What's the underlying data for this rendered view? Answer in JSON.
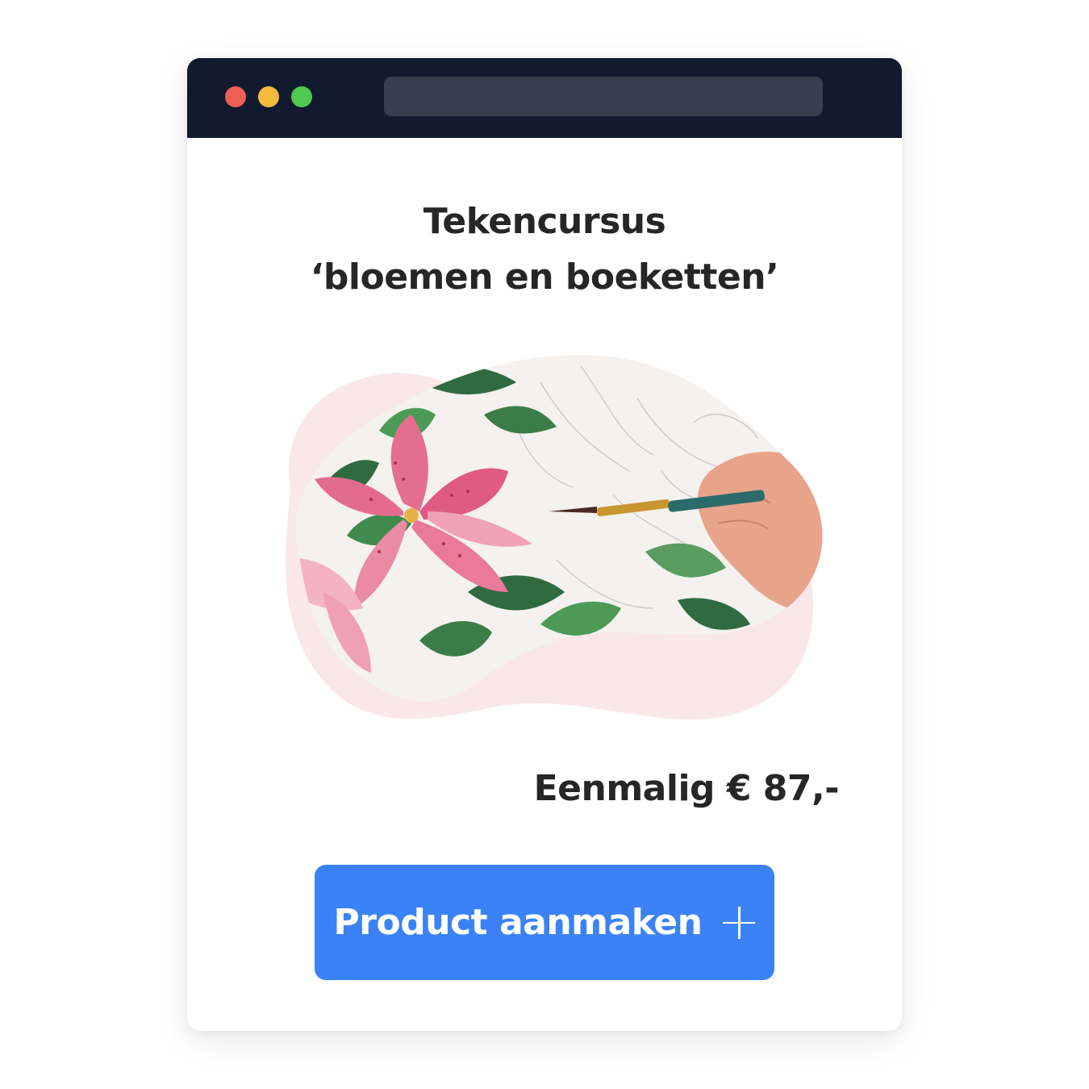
{
  "window": {
    "controls": [
      "close",
      "minimize",
      "maximize"
    ],
    "address_bar": ""
  },
  "product": {
    "title_line1": "Tekencursus",
    "title_line2": "‘bloemen en boeketten’",
    "image": "watercolor-lily-painting",
    "price": "Eenmalig € 87,-"
  },
  "cta": {
    "label": "Product aanmaken",
    "icon": "plus-icon"
  },
  "colors": {
    "titlebar": "#111a2e",
    "accent": "#3b82f6",
    "blob_pink": "#fae7ea",
    "text": "#262626"
  }
}
